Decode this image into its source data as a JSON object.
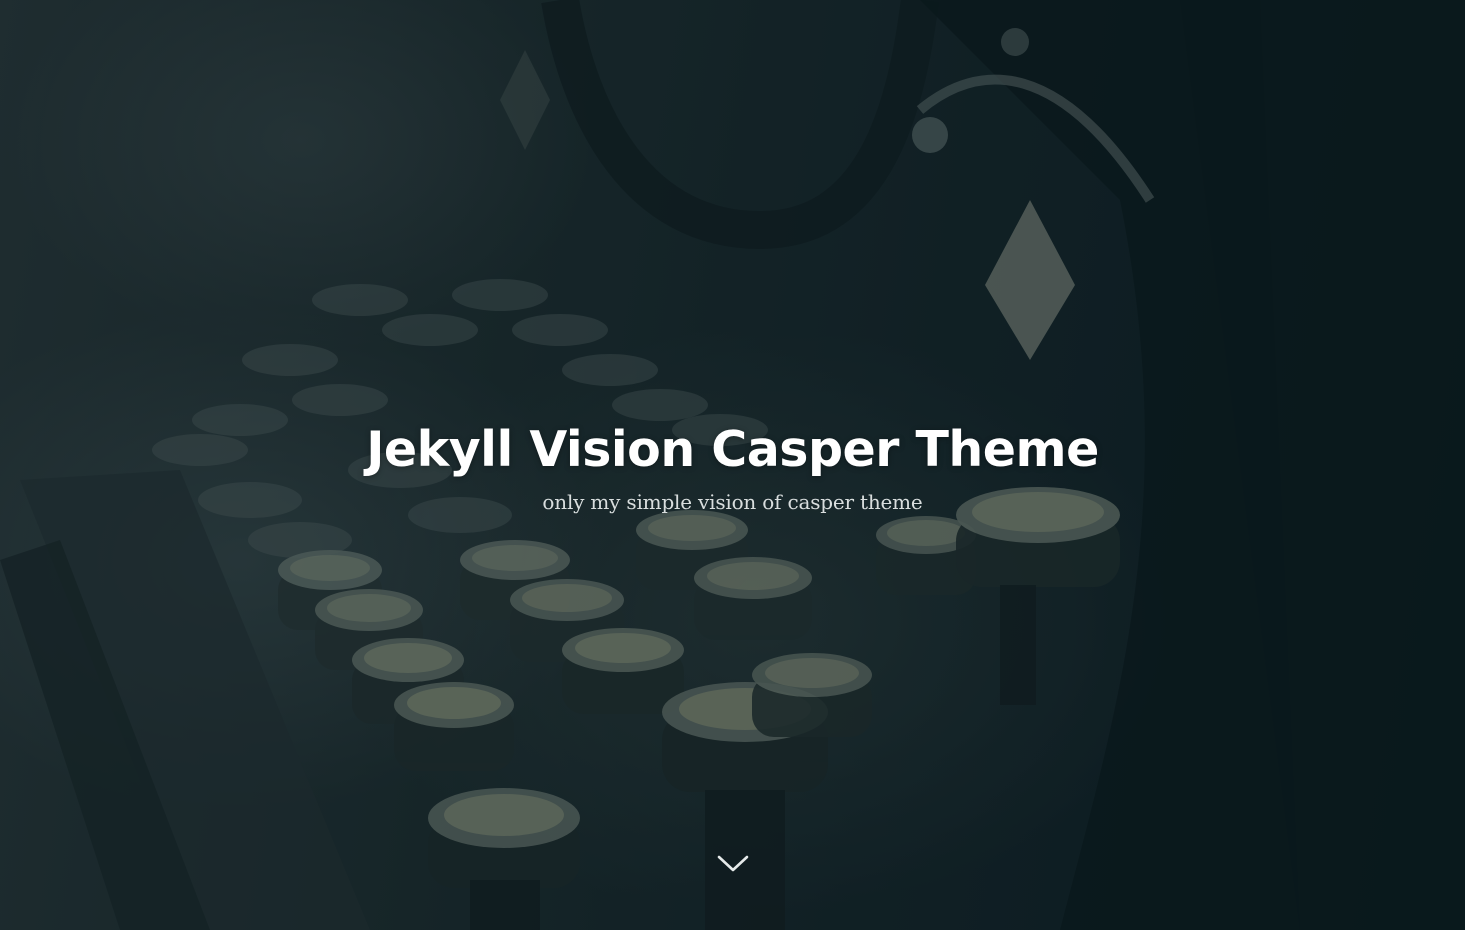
{
  "site": {
    "title": "Jekyll Vision Casper Theme",
    "description": "only my simple vision of casper theme"
  },
  "scroll_down": {
    "icon": "chevron-down-icon",
    "color": "#e6eaea"
  },
  "colors": {
    "overlay": "#0a1c22",
    "title": "#ffffff",
    "description": "#d9dede"
  }
}
